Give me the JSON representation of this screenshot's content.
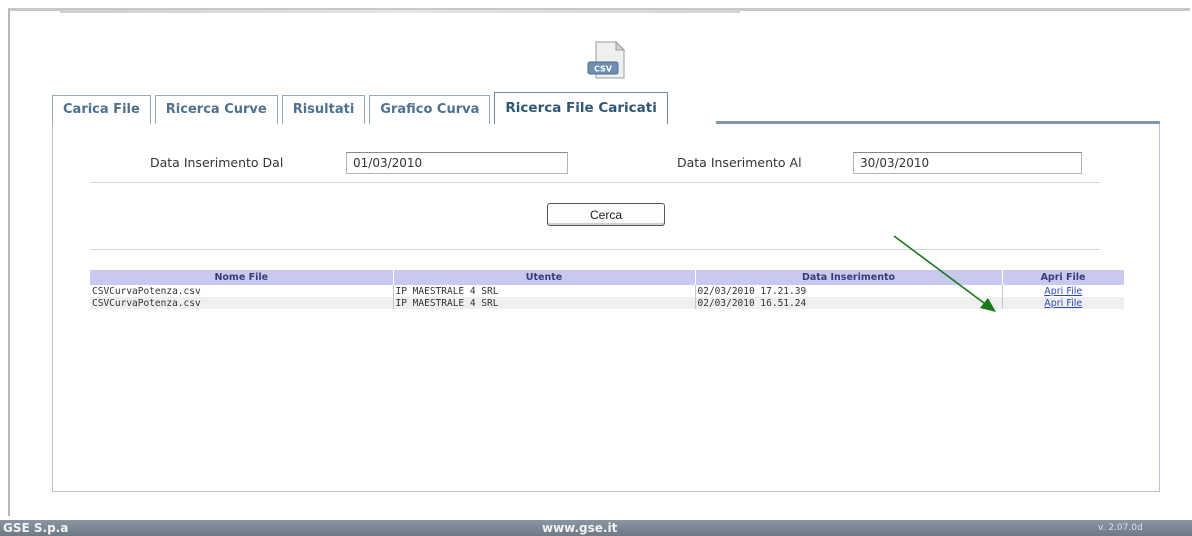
{
  "icon": {
    "name": "csv-file-icon",
    "caption": "CSV"
  },
  "tabs": [
    {
      "label": "Carica File",
      "active": false
    },
    {
      "label": "Ricerca Curve",
      "active": false
    },
    {
      "label": "Risultati",
      "active": false
    },
    {
      "label": "Grafico Curva",
      "active": false
    },
    {
      "label": "Ricerca File Caricati",
      "active": true
    }
  ],
  "search": {
    "from_label": "Data Inserimento Dal",
    "from_value": "01/03/2010",
    "to_label": "Data Inserimento Al",
    "to_value": "30/03/2010",
    "button_label": "Cerca"
  },
  "table": {
    "columns": [
      "Nome File",
      "Utente",
      "Data Inserimento",
      "Apri File"
    ],
    "rows": [
      {
        "file": "CSVCurvaPotenza.csv",
        "user": "IP MAESTRALE 4 SRL",
        "date": "02/03/2010 17.21.39",
        "action": "Apri File"
      },
      {
        "file": "CSVCurvaPotenza.csv",
        "user": "IP MAESTRALE 4 SRL",
        "date": "02/03/2010 16.51.24",
        "action": "Apri File"
      }
    ]
  },
  "annotation": {
    "color": "#1a7a1a",
    "icon": "green-arrow"
  },
  "footer": {
    "company": "GSE S.p.a",
    "website": "www.gse.it",
    "version": "v. 2.07.0d"
  },
  "colors": {
    "tab_text": "#4f7190",
    "header_bg": "#c9c9f0",
    "link": "#2b46b5",
    "footer_bg": "#7d8a96"
  }
}
